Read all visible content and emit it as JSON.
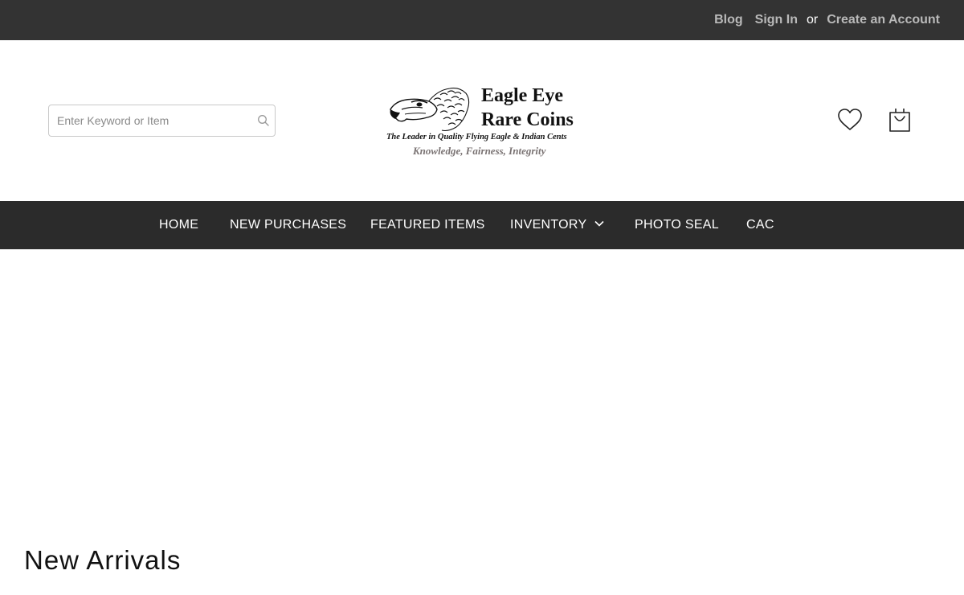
{
  "topbar": {
    "blog": "Blog",
    "sign_in": "Sign In",
    "or": "or",
    "create_account": "Create an Account",
    "link_color": "#b9b9b9",
    "background": "#333333"
  },
  "search": {
    "placeholder": "Enter Keyword or Item",
    "value": "",
    "icon": "search-icon"
  },
  "logo": {
    "line1": "Eagle Eye",
    "line2": "Rare Coins",
    "tagline": "The Leader in Quality Flying Eagle & Indian Cents",
    "motto": "Knowledge, Fairness, Integrity"
  },
  "header_icons": {
    "wishlist": "heart-icon",
    "cart": "shopping-bag-icon"
  },
  "nav": {
    "background": "#2b2b2b",
    "items": [
      {
        "label": "HOME"
      },
      {
        "label": "NEW PURCHASES"
      },
      {
        "label": "FEATURED ITEMS"
      },
      {
        "label": "INVENTORY",
        "has_dropdown": true
      },
      {
        "label": "PHOTO SEAL"
      },
      {
        "label": "CAC"
      }
    ]
  },
  "main": {
    "section_title": "New Arrivals"
  }
}
